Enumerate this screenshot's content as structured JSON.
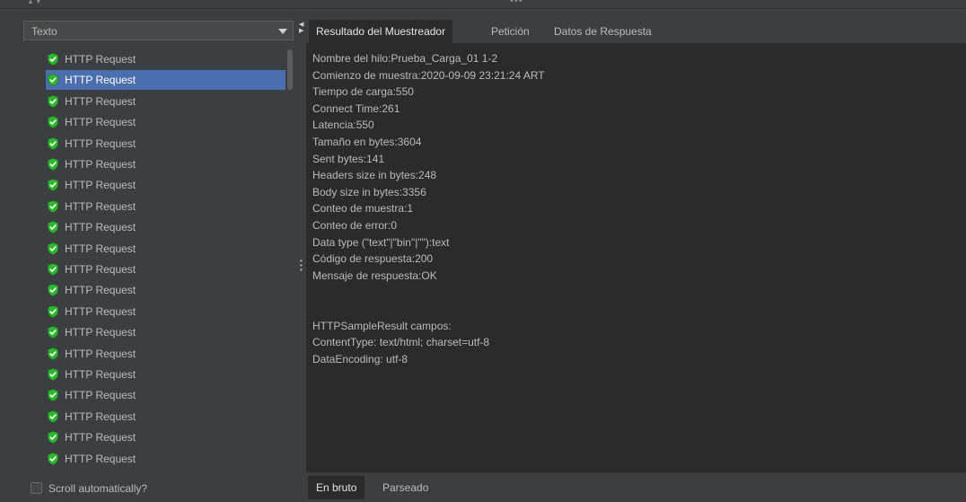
{
  "left_panel": {
    "renderer_select": {
      "value": "Texto"
    },
    "tree": {
      "items": [
        {
          "label": "HTTP Request",
          "status": "success",
          "selected": false
        },
        {
          "label": "HTTP Request",
          "status": "success",
          "selected": true
        },
        {
          "label": "HTTP Request",
          "status": "success",
          "selected": false
        },
        {
          "label": "HTTP Request",
          "status": "success",
          "selected": false
        },
        {
          "label": "HTTP Request",
          "status": "success",
          "selected": false
        },
        {
          "label": "HTTP Request",
          "status": "success",
          "selected": false
        },
        {
          "label": "HTTP Request",
          "status": "success",
          "selected": false
        },
        {
          "label": "HTTP Request",
          "status": "success",
          "selected": false
        },
        {
          "label": "HTTP Request",
          "status": "success",
          "selected": false
        },
        {
          "label": "HTTP Request",
          "status": "success",
          "selected": false
        },
        {
          "label": "HTTP Request",
          "status": "success",
          "selected": false
        },
        {
          "label": "HTTP Request",
          "status": "success",
          "selected": false
        },
        {
          "label": "HTTP Request",
          "status": "success",
          "selected": false
        },
        {
          "label": "HTTP Request",
          "status": "success",
          "selected": false
        },
        {
          "label": "HTTP Request",
          "status": "success",
          "selected": false
        },
        {
          "label": "HTTP Request",
          "status": "success",
          "selected": false
        },
        {
          "label": "HTTP Request",
          "status": "success",
          "selected": false
        },
        {
          "label": "HTTP Request",
          "status": "success",
          "selected": false
        },
        {
          "label": "HTTP Request",
          "status": "success",
          "selected": false
        },
        {
          "label": "HTTP Request",
          "status": "success",
          "selected": false
        }
      ],
      "icon": "green-shield-check-icon"
    },
    "auto_scroll": {
      "label": "Scroll automatically?",
      "checked": false
    }
  },
  "right_panel": {
    "tabs": [
      {
        "label": "Resultado del Muestreador",
        "active": true
      },
      {
        "label": "Petición",
        "active": false
      },
      {
        "label": "Datos de Respuesta",
        "active": false
      }
    ],
    "lines": [
      "Nombre del hilo:Prueba_Carga_01 1-2",
      "Comienzo de muestra:2020-09-09 23:21:24 ART",
      "Tiempo de carga:550",
      "Connect Time:261",
      "Latencia:550",
      "Tamaño en bytes:3604",
      "Sent bytes:141",
      "Headers size in bytes:248",
      "Body size in bytes:3356",
      "Conteo de muestra:1",
      "Conteo de error:0",
      "Data type (\"text\"|\"bin\"|\"\"):text",
      "Código de respuesta:200",
      "Mensaje de respuesta:OK",
      "",
      "",
      "HTTPSampleResult campos:",
      "ContentType: text/html; charset=utf-8",
      "DataEncoding: utf-8"
    ],
    "bottom_tabs": [
      {
        "label": "En bruto",
        "active": true
      },
      {
        "label": "Parseado",
        "active": false
      }
    ]
  },
  "colors": {
    "background": "#2b2b2b",
    "panel": "#3c3f41",
    "selection": "#4b6eaf",
    "success_icon": "#3ec23e",
    "text": "#bbbbbb"
  }
}
